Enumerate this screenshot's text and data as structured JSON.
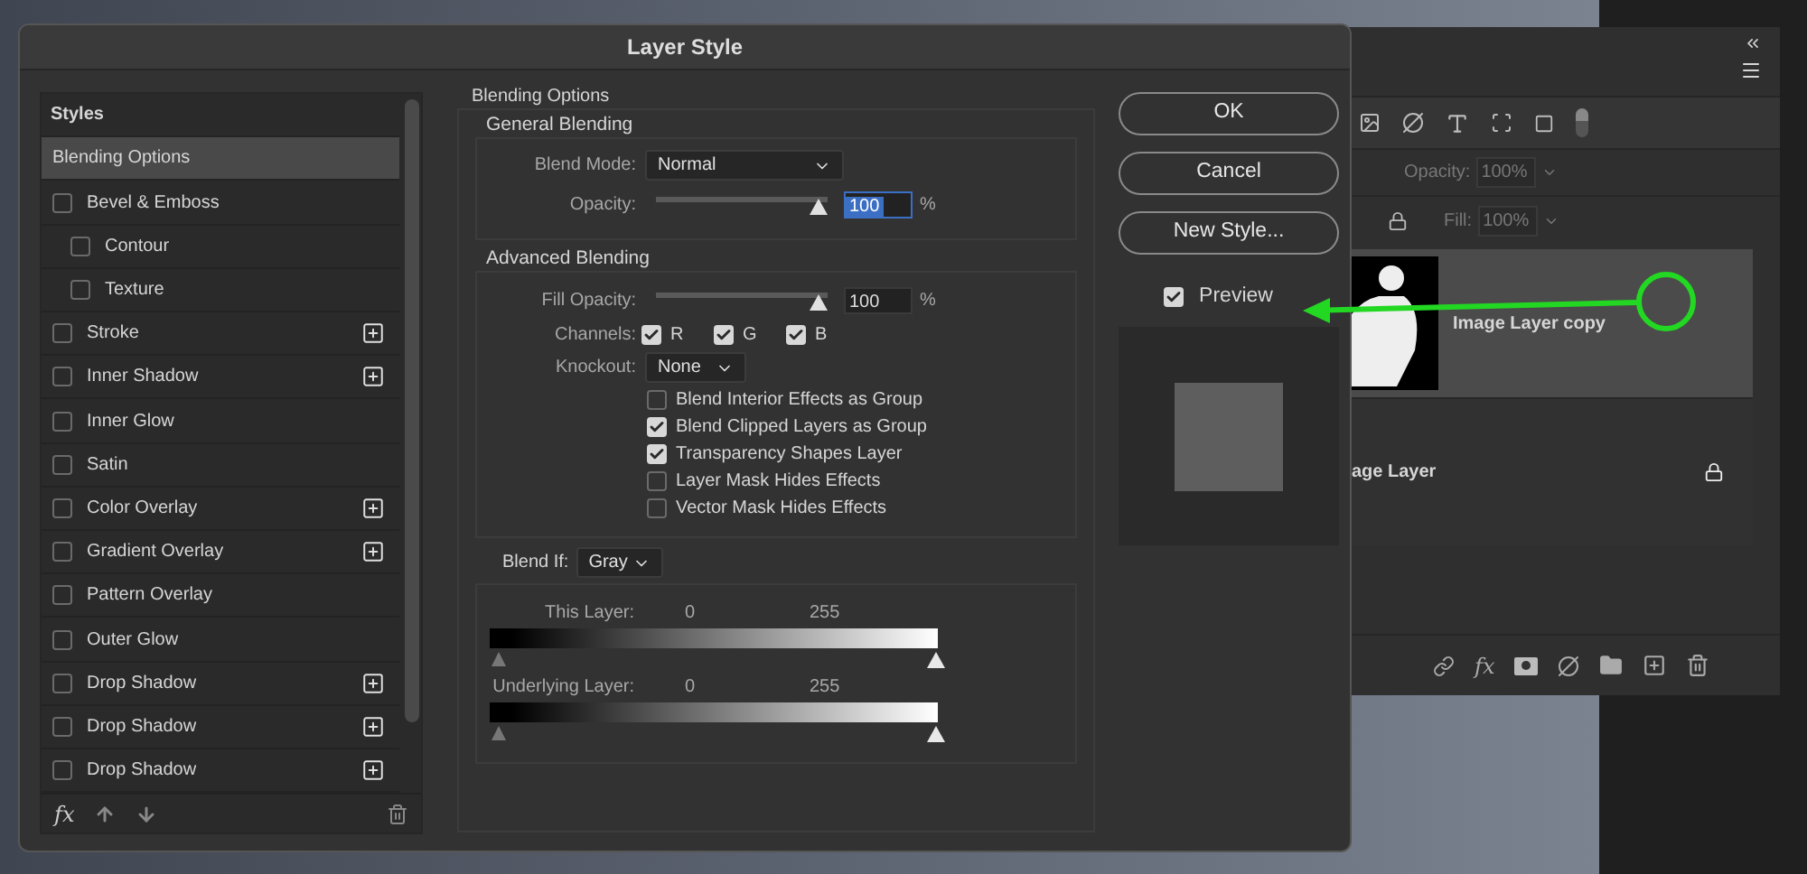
{
  "window": {
    "title": "Layer Style"
  },
  "styles_list": {
    "header": "Styles",
    "items": [
      {
        "label": "Blending Options",
        "kind": "plain",
        "selected": true
      },
      {
        "label": "Bevel & Emboss",
        "kind": "check",
        "checked": false,
        "selected": false,
        "add_button": false,
        "children": [
          {
            "label": "Contour",
            "kind": "check",
            "checked": false,
            "selected": false,
            "add_button": false
          },
          {
            "label": "Texture",
            "kind": "check",
            "checked": false,
            "selected": false,
            "add_button": false
          }
        ]
      },
      {
        "label": "Stroke",
        "kind": "check",
        "checked": false,
        "selected": false,
        "add_button": true
      },
      {
        "label": "Inner Shadow",
        "kind": "check",
        "checked": false,
        "selected": false,
        "add_button": true
      },
      {
        "label": "Inner Glow",
        "kind": "check",
        "checked": false,
        "selected": false,
        "add_button": false
      },
      {
        "label": "Satin",
        "kind": "check",
        "checked": false,
        "selected": false,
        "add_button": false
      },
      {
        "label": "Color Overlay",
        "kind": "check",
        "checked": false,
        "selected": false,
        "add_button": true
      },
      {
        "label": "Gradient Overlay",
        "kind": "check",
        "checked": false,
        "selected": false,
        "add_button": true
      },
      {
        "label": "Pattern Overlay",
        "kind": "check",
        "checked": false,
        "selected": false,
        "add_button": false
      },
      {
        "label": "Outer Glow",
        "kind": "check",
        "checked": false,
        "selected": false,
        "add_button": false
      },
      {
        "label": "Drop Shadow",
        "kind": "check",
        "checked": false,
        "selected": false,
        "add_button": true
      },
      {
        "label": "Drop Shadow",
        "kind": "check",
        "checked": false,
        "selected": false,
        "add_button": true
      },
      {
        "label": "Drop Shadow",
        "kind": "check",
        "checked": false,
        "selected": false,
        "add_button": true
      }
    ],
    "footer_fx": "fx"
  },
  "blending_options": {
    "title": "Blending Options",
    "general": {
      "title": "General Blending",
      "blend_mode": {
        "label": "Blend Mode:",
        "value": "Normal"
      },
      "opacity": {
        "label": "Opacity:",
        "level": 1,
        "value": "100",
        "selected": true,
        "unit": "%"
      }
    },
    "advanced": {
      "title": "Advanced Blending",
      "fill_opacity": {
        "label": "Fill Opacity:",
        "level": 1,
        "value": "100",
        "selected": false,
        "unit": "%"
      },
      "channels": {
        "label": "Channels:",
        "items": [
          {
            "label": "R",
            "checked": true
          },
          {
            "label": "G",
            "checked": true
          },
          {
            "label": "B",
            "checked": true
          }
        ]
      },
      "knockout": {
        "label": "Knockout:",
        "value": "None"
      },
      "options": [
        {
          "label": "Blend Interior Effects as Group",
          "checked": false
        },
        {
          "label": "Blend Clipped Layers as Group",
          "checked": true
        },
        {
          "label": "Transparency Shapes Layer",
          "checked": true
        },
        {
          "label": "Layer Mask Hides Effects",
          "checked": false
        },
        {
          "label": "Vector Mask Hides Effects",
          "checked": false
        }
      ]
    },
    "blend_if": {
      "label": "Blend If:",
      "value": "Gray",
      "sliders": [
        {
          "label": "This Layer:",
          "low": "0",
          "high": "255"
        },
        {
          "label": "Underlying Layer:",
          "low": "0",
          "high": "255"
        }
      ]
    }
  },
  "buttons": [
    "OK",
    "Cancel",
    "New Style..."
  ],
  "preview": {
    "label": "Preview",
    "checked": true
  },
  "layers_panel": {
    "opacity": {
      "label": "Opacity:",
      "value": "100%"
    },
    "fill": {
      "label": "Fill:",
      "value": "100%"
    },
    "layers": [
      {
        "name": "Image Layer copy",
        "selected": true,
        "locked": false,
        "kind": "mask"
      },
      {
        "name": "age Layer",
        "selected": false,
        "locked": true,
        "kind": "hidden-thumb"
      }
    ],
    "footer_fx": "fx"
  }
}
